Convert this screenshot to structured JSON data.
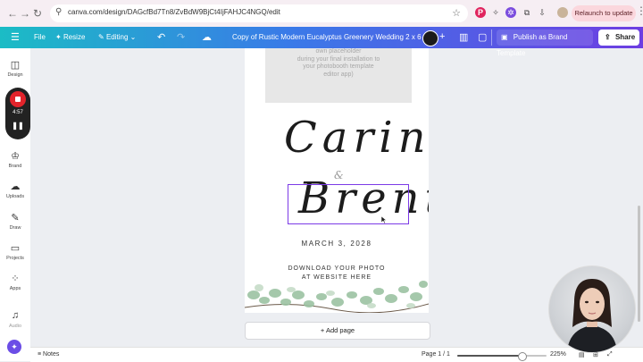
{
  "browser": {
    "url": "canva.com/design/DAGcfBd7Tn8/ZvBdW9BjCt4IjFAHJC4NGQ/edit",
    "relaunch_label": "Relaunch to update"
  },
  "toolbar": {
    "file_label": "File",
    "resize_label": "Resize",
    "editing_label": "Editing",
    "document_title": "Copy of Rustic Modern Eucalyptus Greenery Wedding 2 x 6 ...",
    "publish_label": "Publish as Brand Template",
    "share_label": "Share"
  },
  "sidebar": {
    "items": [
      {
        "label": "Design",
        "icon": "layout-icon"
      },
      {
        "label": "Brand",
        "icon": "brand-icon"
      },
      {
        "label": "Uploads",
        "icon": "cloud-upload-icon"
      },
      {
        "label": "Draw",
        "icon": "pen-icon"
      },
      {
        "label": "Projects",
        "icon": "folder-icon"
      },
      {
        "label": "Apps",
        "icon": "apps-icon"
      },
      {
        "label": "Audio",
        "icon": "music-icon"
      }
    ],
    "recorder_time": "4:57"
  },
  "canvas": {
    "placeholder_text": [
      "own placeholder",
      "during your final installation to",
      "your photobooth template",
      "editor app)"
    ],
    "name_first": "Carina",
    "ampersand": "&",
    "name_second": "Brent",
    "date": "MARCH 3, 2028",
    "download_line1": "DOWNLOAD YOUR PHOTO",
    "download_line2": "AT WEBSITE HERE"
  },
  "add_page_label": "+ Add page",
  "bottombar": {
    "notes_label": "Notes",
    "page_indicator": "Page 1 / 1",
    "zoom": "225%",
    "zoom_fraction": 0.72
  },
  "colors": {
    "accent_purple": "#7c3ae6",
    "toolbar_start": "#1bbcc5",
    "toolbar_end": "#6d3ee2",
    "record_red": "#e3242b"
  }
}
